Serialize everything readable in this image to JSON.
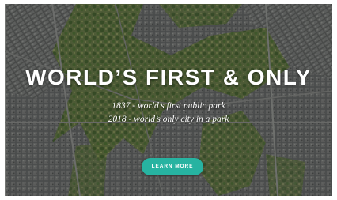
{
  "hero": {
    "headline": "WORLD’S FIRST & ONLY",
    "line1": "1837 - world’s first public park",
    "line2": "2018 - world’s only city in a park",
    "cta_label": "LEARN MORE"
  },
  "colors": {
    "cta_background": "#27b3a1",
    "text": "#ffffff"
  }
}
